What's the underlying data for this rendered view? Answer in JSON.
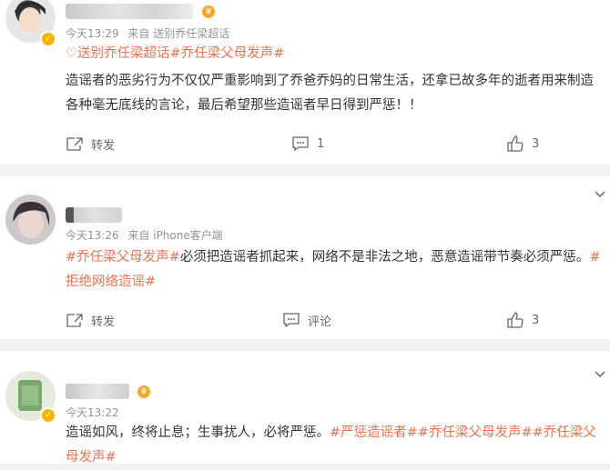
{
  "posts": [
    {
      "time": "今天13:29",
      "source": "来自 送别乔任梁超话",
      "text_prefix": "♡",
      "tags_top": [
        {
          "t": "送别乔任梁超话",
          "tag": true
        },
        {
          "t": "#乔任梁父母发声#",
          "tag": true
        }
      ],
      "body": "造谣者的恶劣行为不仅仅严重影响到了乔爸乔妈的日常生活，还拿已故多年的逝者用来制造各种毫无底线的言论，最后希望那些造谣者早日得到严惩！！",
      "actions": {
        "forward": "转发",
        "comment": "1",
        "like": "3"
      }
    },
    {
      "time": "今天13:26",
      "source": "来自 iPhone客户端",
      "segments": [
        {
          "t": "#乔任梁父母发声#",
          "tag": true
        },
        {
          "t": "必须把造谣者抓起来，网络不是非法之地，恶意造谣带节奏必须严惩。",
          "tag": false
        },
        {
          "t": "#拒绝网络造谣#",
          "tag": true
        }
      ],
      "actions": {
        "forward": "转发",
        "comment": "评论",
        "like": "3"
      }
    },
    {
      "time": "今天13:22",
      "segments": [
        {
          "t": "造谣如风，终将止息；生事扰人，必将严惩。",
          "tag": false
        },
        {
          "t": "#严惩造谣者#",
          "tag": true
        },
        {
          "t": "#乔任梁父母发声#",
          "tag": true
        },
        {
          "t": "#乔任梁父母发声#",
          "tag": true
        }
      ]
    }
  ],
  "icons": {
    "forward": "forward-icon",
    "comment": "comment-icon",
    "like": "thumbs-up-icon",
    "more": "chevron-down-icon",
    "verified": "verified-badge-icon"
  },
  "colors": {
    "tag": "#eb7350",
    "meta": "#939393",
    "badge": "#f5b400"
  }
}
